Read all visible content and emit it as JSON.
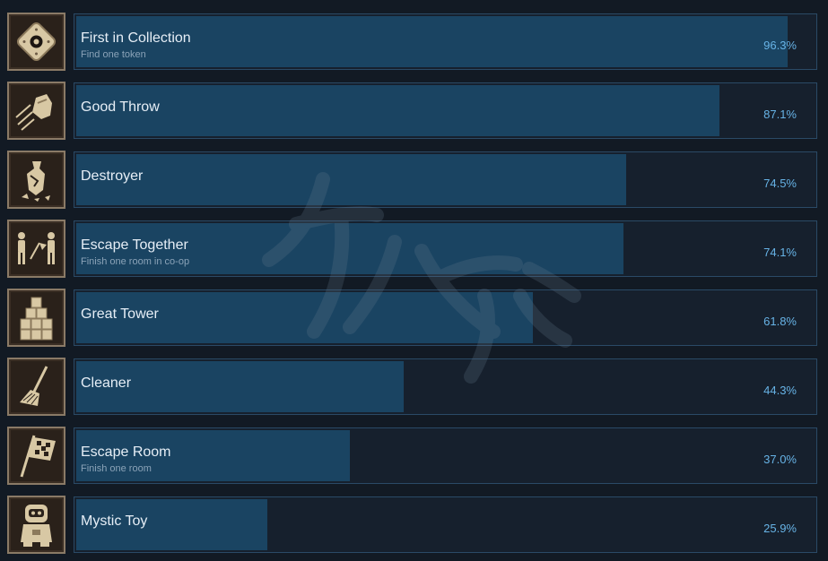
{
  "achievements": [
    {
      "title": "First in Collection",
      "desc": "Find one token",
      "pct_text": "96.3%",
      "pct": 96.3,
      "icon": "token-icon"
    },
    {
      "title": "Good Throw",
      "desc": "",
      "pct_text": "87.1%",
      "pct": 87.1,
      "icon": "throw-icon"
    },
    {
      "title": "Destroyer",
      "desc": "",
      "pct_text": "74.5%",
      "pct": 74.5,
      "icon": "broken-vase-icon"
    },
    {
      "title": "Escape Together",
      "desc": "Finish one room in co-op",
      "pct_text": "74.1%",
      "pct": 74.1,
      "icon": "two-people-icon"
    },
    {
      "title": "Great Tower",
      "desc": "",
      "pct_text": "61.8%",
      "pct": 61.8,
      "icon": "block-tower-icon"
    },
    {
      "title": "Cleaner",
      "desc": "",
      "pct_text": "44.3%",
      "pct": 44.3,
      "icon": "broom-icon"
    },
    {
      "title": "Escape Room",
      "desc": "Finish one room",
      "pct_text": "37.0%",
      "pct": 37.0,
      "icon": "checkered-flag-icon"
    },
    {
      "title": "Mystic Toy",
      "desc": "",
      "pct_text": "25.9%",
      "pct": 25.9,
      "icon": "toy-robot-icon"
    }
  ],
  "colors": {
    "background": "#121a24",
    "panel": "#16202d",
    "bar_fill": "#1a4462",
    "percent_text": "#67b3e6",
    "icon_gold": "#d8c8a4"
  }
}
